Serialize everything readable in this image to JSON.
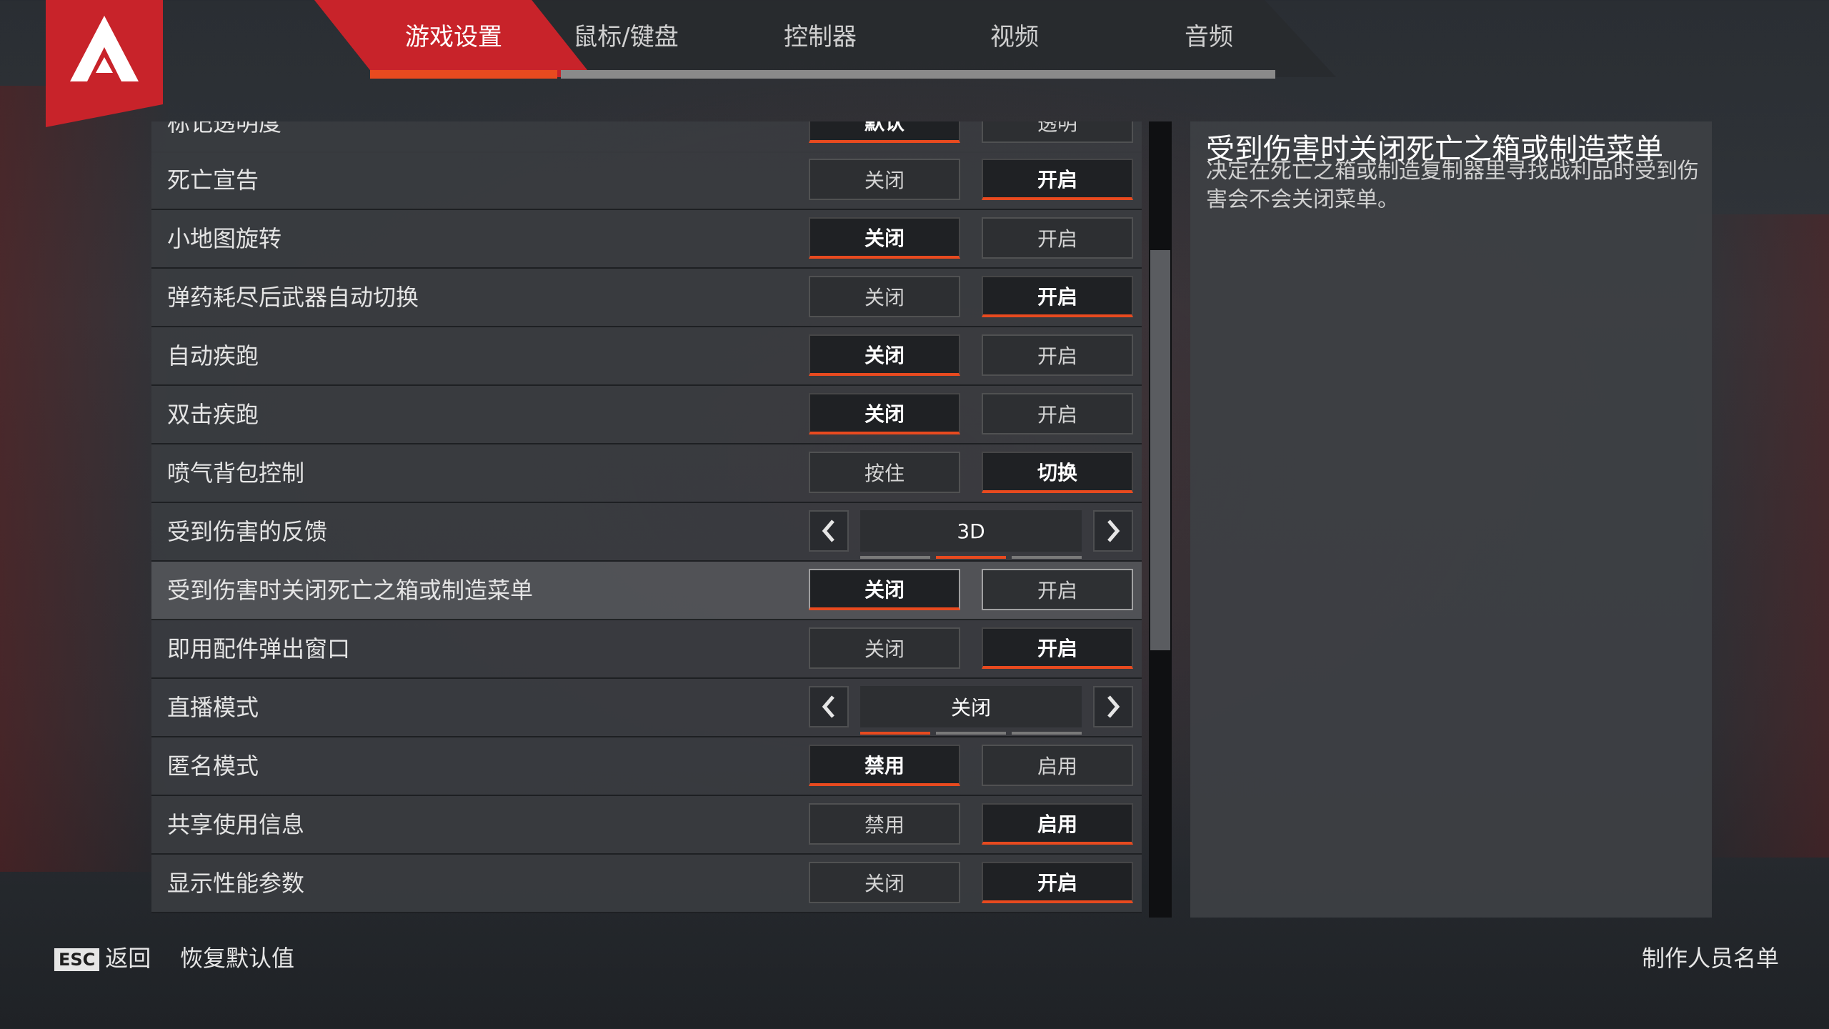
{
  "tabs": [
    {
      "label": "游戏设置",
      "active": true
    },
    {
      "label": "鼠标/键盘",
      "active": false
    },
    {
      "label": "控制器",
      "active": false
    },
    {
      "label": "视频",
      "active": false
    },
    {
      "label": "音频",
      "active": false
    }
  ],
  "settings": [
    {
      "label": "标记透明度",
      "options": [
        "默认",
        "透明"
      ],
      "selected": 0
    },
    {
      "label": "死亡宣告",
      "options": [
        "关闭",
        "开启"
      ],
      "selected": 1
    },
    {
      "label": "小地图旋转",
      "options": [
        "关闭",
        "开启"
      ],
      "selected": 0
    },
    {
      "label": "弹药耗尽后武器自动切换",
      "options": [
        "关闭",
        "开启"
      ],
      "selected": 1
    },
    {
      "label": "自动疾跑",
      "options": [
        "关闭",
        "开启"
      ],
      "selected": 0
    },
    {
      "label": "双击疾跑",
      "options": [
        "关闭",
        "开启"
      ],
      "selected": 0
    },
    {
      "label": "喷气背包控制",
      "options": [
        "按住",
        "切换"
      ],
      "selected": 1
    },
    {
      "label": "受到伤害的反馈",
      "stepper_value": "3D",
      "stepper_position": 2
    },
    {
      "label": "受到伤害时关闭死亡之箱或制造菜单",
      "options": [
        "关闭",
        "开启"
      ],
      "selected": 0,
      "highlighted": true
    },
    {
      "label": "即用配件弹出窗口",
      "options": [
        "关闭",
        "开启"
      ],
      "selected": 1
    },
    {
      "label": "直播模式",
      "stepper_value": "关闭",
      "stepper_position": 1
    },
    {
      "label": "匿名模式",
      "options": [
        "禁用",
        "启用"
      ],
      "selected": 0
    },
    {
      "label": "共享使用信息",
      "options": [
        "禁用",
        "启用"
      ],
      "selected": 1
    },
    {
      "label": "显示性能参数",
      "options": [
        "关闭",
        "开启"
      ],
      "selected": 1
    }
  ],
  "description": {
    "title": "受到伤害时关闭死亡之箱或制造菜单",
    "body": "决定在死亡之箱或制造复制器里寻找战利品时受到伤害会不会关闭菜单。"
  },
  "footer": {
    "esc_key": "ESC",
    "back": "返回",
    "reset": "恢复默认值",
    "credits": "制作人员名单"
  },
  "colors": {
    "accent": "#e84a1f",
    "brand_red": "#c8232a"
  }
}
